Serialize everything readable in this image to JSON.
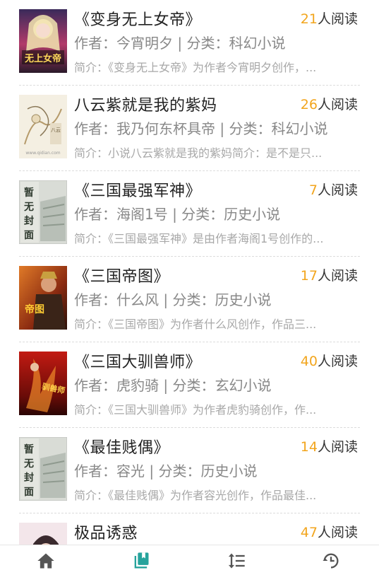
{
  "books": [
    {
      "title": "《变身无上女帝》",
      "count": "21",
      "reads_suffix": "人阅读",
      "meta": "作者：今宵明夕 | 分类：科幻小说",
      "intro": "简介：《变身无上女帝》为作者今宵明夕创作，...",
      "cover": "anime-girl-cover"
    },
    {
      "title": "八云紫就是我的紫妈",
      "count": "26",
      "reads_suffix": "人阅读",
      "meta": "作者：我乃何东杯具帝 | 分类：科幻小说",
      "intro": "简介：小说八云紫就是我的紫妈简介：是不是只...",
      "cover": "ink-sketch-cover"
    },
    {
      "title": "《三国最强军神》",
      "count": "7",
      "reads_suffix": "人阅读",
      "meta": "作者：海阁1号 | 分类：历史小说",
      "intro": "简介：《三国最强军神》是由作者海阁1号创作的...",
      "cover": "no-cover-placeholder"
    },
    {
      "title": "《三国帝图》",
      "count": "17",
      "reads_suffix": "人阅读",
      "meta": "作者：什么风 | 分类：历史小说",
      "intro": "简介：《三国帝图》为作者什么风创作，作品三...",
      "cover": "warrior-cover"
    },
    {
      "title": "《三国大驯兽师》",
      "count": "40",
      "reads_suffix": "人阅读",
      "meta": "作者：虎豹骑 | 分类：玄幻小说",
      "intro": "简介：《三国大驯兽师》为作者虎豹骑创作，作...",
      "cover": "red-fire-cover"
    },
    {
      "title": "《最佳贱偶》",
      "count": "14",
      "reads_suffix": "人阅读",
      "meta": "作者：容光 | 分类：历史小说",
      "intro": "简介：《最佳贱偶》为作者容光创作，作品最佳...",
      "cover": "no-cover-placeholder"
    },
    {
      "title": "极品诱惑",
      "count": "47",
      "reads_suffix": "人阅读",
      "meta": "",
      "intro": "",
      "cover": "portrait-cover"
    }
  ],
  "covers": {
    "anime_text": "无上女帝",
    "placeholder_text": [
      "暂",
      "无",
      "封",
      "面"
    ],
    "warrior_text": "帝图",
    "red_text": "驯兽师"
  },
  "tabbar": {
    "tabs": [
      {
        "name": "home",
        "icon": "home-icon",
        "active": false
      },
      {
        "name": "bookshelf",
        "icon": "book-icon",
        "active": true
      },
      {
        "name": "sort",
        "icon": "sort-icon",
        "active": false
      },
      {
        "name": "history",
        "icon": "history-icon",
        "active": false
      }
    ]
  },
  "colors": {
    "accent": "#26a39c",
    "count": "#f2a51d",
    "icon": "#555555"
  }
}
